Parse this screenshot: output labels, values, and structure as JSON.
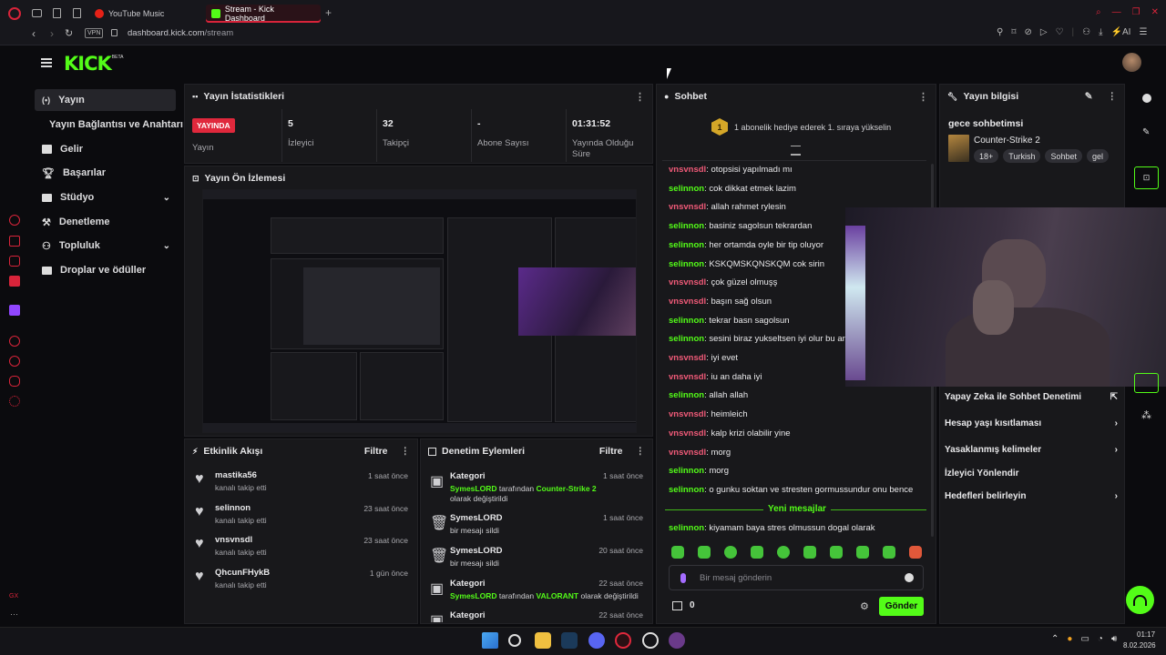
{
  "browser": {
    "tabs": [
      {
        "label": "YouTube Music"
      },
      {
        "label": "Stream - Kick Dashboard"
      }
    ],
    "vpn_badge": "VPN",
    "url_domain": "dashboard.kick.com",
    "url_path": "/stream",
    "ai_label": "AI"
  },
  "header": {
    "logo": "KICK",
    "logo_badge": "BETA"
  },
  "sidebar": {
    "items": [
      {
        "label": "Yayın"
      },
      {
        "label": "Yayın Bağlantısı ve Anahtarı"
      },
      {
        "label": "Gelir"
      },
      {
        "label": "Başarılar"
      },
      {
        "label": "Stüdyo"
      },
      {
        "label": "Denetleme"
      },
      {
        "label": "Topluluk"
      },
      {
        "label": "Droplar ve ödüller"
      }
    ],
    "bottom_label": "GX"
  },
  "stats": {
    "title": "Yayın İstatistikleri",
    "live_badge": "YAYINDA",
    "live_label": "Yayın",
    "items": [
      {
        "value": "5",
        "label": "İzleyici"
      },
      {
        "value": "32",
        "label": "Takipçi"
      },
      {
        "value": "-",
        "label": "Abone Sayısı"
      },
      {
        "value": "01:31:52",
        "label": "Yayında Olduğu Süre"
      }
    ]
  },
  "preview": {
    "title": "Yayın Ön İzlemesi"
  },
  "activity": {
    "title": "Etkinlik Akışı",
    "filter": "Filtre",
    "items": [
      {
        "user": "mastika56",
        "desc": "kanalı takip etti",
        "time": "1 saat önce"
      },
      {
        "user": "selinnon",
        "desc": "kanalı takip etti",
        "time": "23 saat önce"
      },
      {
        "user": "vnsvnsdl",
        "desc": "kanalı takip etti",
        "time": "23 saat önce"
      },
      {
        "user": "QhcunFHykB",
        "desc": "kanalı takip etti",
        "time": "1 gün önce"
      }
    ]
  },
  "moderation": {
    "title": "Denetim Eylemleri",
    "filter": "Filtre",
    "items": [
      {
        "title": "Kategori",
        "actor": "SymesLORD",
        "mid": " tarafından ",
        "target": "Counter-Strike 2",
        "tail": " olarak değiştirildi",
        "time": "1 saat önce"
      },
      {
        "title": "SymesLORD",
        "desc": "bir mesajı sildi",
        "time": "1 saat önce"
      },
      {
        "title": "SymesLORD",
        "desc": "bir mesajı sildi",
        "time": "20 saat önce"
      },
      {
        "title": "Kategori",
        "actor": "SymesLORD",
        "mid": " tarafından ",
        "target": "VALORANT",
        "tail": " olarak değiştirildi",
        "time": "22 saat önce"
      },
      {
        "title": "Kategori",
        "time": "22 saat önce"
      }
    ]
  },
  "chat": {
    "title": "Sohbet",
    "gift_rank": "1",
    "gift_text": "1 abonelik hediye ederek 1. sıraya yükselin",
    "messages": [
      {
        "user": "vnsvnsdl",
        "text": "otopsisi yapılmadı mı"
      },
      {
        "user": "selinnon",
        "text": "cok dikkat etmek lazim"
      },
      {
        "user": "vnsvnsdl",
        "text": "allah rahmet rylesin"
      },
      {
        "user": "selinnon",
        "text": "basiniz sagolsun tekrardan"
      },
      {
        "user": "selinnon",
        "text": "her ortamda oyle bir tip oluyor"
      },
      {
        "user": "selinnon",
        "text": "KSKQMSKQNSKQM cok sirin"
      },
      {
        "user": "vnsvnsdl",
        "text": "çok güzel olmuşş"
      },
      {
        "user": "vnsvnsdl",
        "text": "başın sağ olsun"
      },
      {
        "user": "selinnon",
        "text": "tekrar basn sagolsun"
      },
      {
        "user": "selinnon",
        "text": "sesini biraz yukseltsen iyi olur bu arada"
      },
      {
        "user": "vnsvnsdl",
        "text": "iyi evet"
      },
      {
        "user": "vnsvnsdl",
        "text": "iu an daha iyi"
      },
      {
        "user": "selinnon",
        "text": "allah allah"
      },
      {
        "user": "vnsvnsdl",
        "text": "heimleich"
      },
      {
        "user": "vnsvnsdl",
        "text": "kalp krizi olabilir yine"
      },
      {
        "user": "vnsvnsdl",
        "text": "morg"
      },
      {
        "user": "selinnon",
        "text": "morg"
      },
      {
        "user": "selinnon",
        "text": "o gunku soktan ve stresten gormussundur onu bence"
      }
    ],
    "new_messages_label": "Yeni mesajlar",
    "last_message": {
      "user": "selinnon",
      "text": "kiyamam baya stres olmussun dogal olarak"
    },
    "input_placeholder": "Bir mesaj gönderin",
    "points": "0",
    "send_label": "Gönder",
    "colors": {
      "vnsvnsdl": "#f05a78",
      "selinnon": "#53fc18"
    }
  },
  "stream_info": {
    "title": "Yayın bilgisi",
    "stream_title": "gece sohbetimsi",
    "category": "Counter-Strike 2",
    "tags": [
      "18+",
      "Turkish",
      "Sohbet",
      "gel"
    ],
    "items": [
      {
        "label": "Yapay Zeka ile Sohbet Denetimi"
      },
      {
        "label": "Hesap yaşı kısıtlaması"
      },
      {
        "label": "Yasaklanmış kelimeler"
      },
      {
        "label": "İzleyici Yönlendir"
      },
      {
        "label": "Hedefleri belirleyin"
      }
    ]
  },
  "taskbar": {
    "time": "01:17",
    "date": "8.02.2026"
  },
  "colors": {
    "accent": "#53fc18",
    "live": "#e0283c",
    "browser_accent": "#d8243a"
  }
}
